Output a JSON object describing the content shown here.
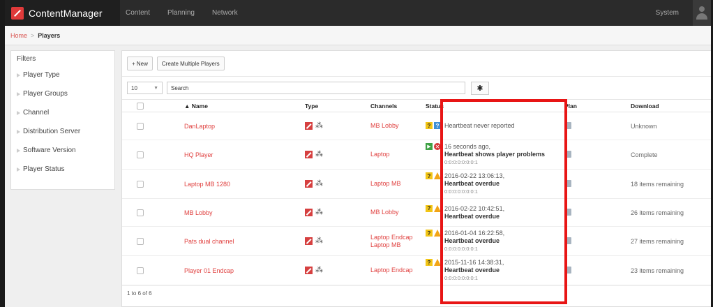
{
  "app": {
    "name": "ContentManager"
  },
  "nav": {
    "items": [
      "Content",
      "Planning",
      "Network"
    ],
    "system_label": "System"
  },
  "breadcrumb": {
    "home": "Home",
    "separator": ">",
    "current": "Players"
  },
  "filters": {
    "title": "Filters",
    "items": [
      "Player Type",
      "Player Groups",
      "Channel",
      "Distribution Server",
      "Software Version",
      "Player Status"
    ]
  },
  "toolbar": {
    "new_label": "+ New",
    "create_multiple_label": "Create Multiple Players"
  },
  "search": {
    "page_size": "10",
    "placeholder": "Search"
  },
  "table": {
    "headers": {
      "name": "▲ Name",
      "type": "Type",
      "channels": "Channels",
      "status": "Status",
      "plan": "Plan",
      "download": "Download"
    },
    "rows": [
      {
        "name": "DanLaptop",
        "channels": [
          "MB Lobby"
        ],
        "status_icons": [
          "question-yellow",
          "question-blue"
        ],
        "status_line1": "Heartbeat never reported",
        "status_line2": "",
        "status_line3": "",
        "download": "Unknown"
      },
      {
        "name": "HQ Player",
        "channels": [
          "Laptop"
        ],
        "status_icons": [
          "play-green",
          "error-red"
        ],
        "status_line1": "16 seconds ago,",
        "status_line2": "Heartbeat shows player problems",
        "status_line3": "0:0:0:0:0:0:0:1",
        "download": "Complete"
      },
      {
        "name": "Laptop MB 1280",
        "channels": [
          "Laptop MB"
        ],
        "status_icons": [
          "question-yellow",
          "warning"
        ],
        "status_line1": "2016-02-22 13:06:13,",
        "status_line2": "Heartbeat overdue",
        "status_line3": "0:0:0:0:0:0:0:1",
        "download": "18 items remaining"
      },
      {
        "name": "MB Lobby",
        "channels": [
          "MB Lobby"
        ],
        "status_icons": [
          "question-yellow",
          "warning"
        ],
        "status_line1": "2016-02-22 10:42:51,",
        "status_line2": "Heartbeat overdue",
        "status_line3": "",
        "download": "26 items remaining"
      },
      {
        "name": "Pats dual channel",
        "channels": [
          "Laptop Endcap",
          "Laptop MB"
        ],
        "status_icons": [
          "question-yellow",
          "warning"
        ],
        "status_line1": "2016-01-04 16:22:58,",
        "status_line2": "Heartbeat overdue",
        "status_line3": "0:0:0:0:0:0:0:1",
        "download": "27 items remaining"
      },
      {
        "name": "Player 01 Endcap",
        "channels": [
          "Laptop Endcap"
        ],
        "status_icons": [
          "question-yellow",
          "warning"
        ],
        "status_line1": "2015-11-16 14:38:31,",
        "status_line2": "Heartbeat overdue",
        "status_line3": "0:0:0:0:0:0:0:1",
        "download": "23 items remaining"
      }
    ],
    "footer": "1 to 6 of 6"
  },
  "colors": {
    "accent": "#e0403f",
    "highlight": "#e81515",
    "nav_bg": "#2b2b2b"
  }
}
